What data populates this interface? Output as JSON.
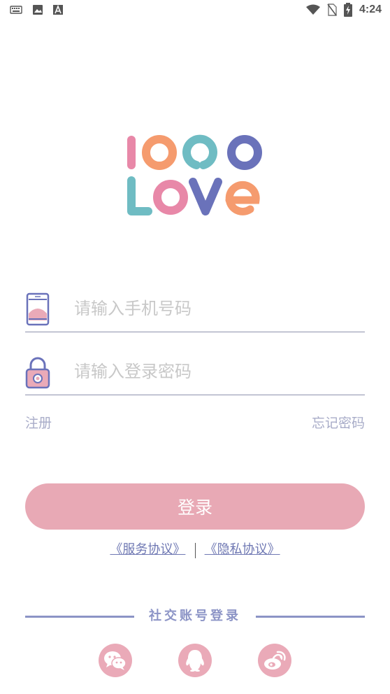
{
  "status_bar": {
    "time": "4:24",
    "left_icons": [
      "keyboard-icon",
      "image-icon",
      "font-a-icon"
    ],
    "right_icons": [
      "wifi-icon",
      "no-sim-icon",
      "battery-charging-icon"
    ]
  },
  "logo": {
    "line1": "1000",
    "line2": "LOVE"
  },
  "form": {
    "phone_placeholder": "请输入手机号码",
    "password_placeholder": "请输入登录密码",
    "register_label": "注册",
    "forgot_label": "忘记密码",
    "login_label": "登录"
  },
  "agreements": {
    "service": "《服务协议》",
    "privacy": "《隐私协议》"
  },
  "social": {
    "title": "社交账号登录",
    "icons": [
      "wechat-icon",
      "qq-icon",
      "weibo-icon"
    ]
  },
  "colors": {
    "accent_pink": "#e8a9b5",
    "accent_blue": "#8c94c6",
    "link_blue": "#6f78b3"
  }
}
